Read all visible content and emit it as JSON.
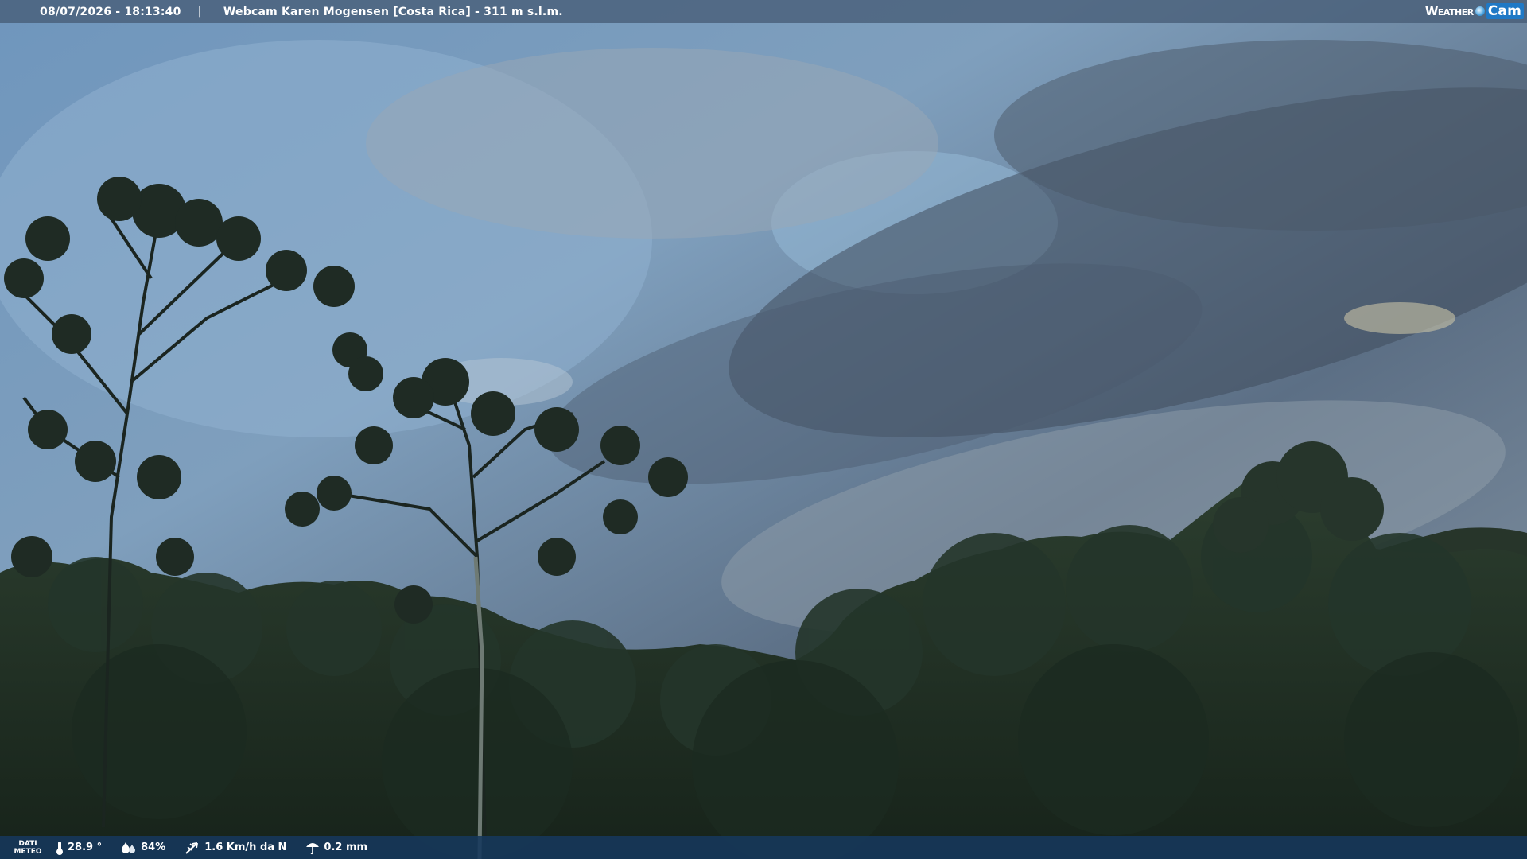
{
  "header": {
    "timestamp": "08/07/2026 - 18:13:40",
    "separator": "|",
    "title": "Webcam Karen Mogensen [Costa Rica]  - 311 m s.l.m."
  },
  "logo": {
    "word1": "Weather",
    "word2": "Cam"
  },
  "weather": {
    "label_line1": "DATI",
    "label_line2": "METEO",
    "temperature": "28.9 °",
    "humidity": "84%",
    "wind": "1.6 Km/h da N",
    "rain": "0.2 mm"
  },
  "colors": {
    "top_bar": "#465c76",
    "bottom_bar": "#16385c",
    "logo_accent": "#1f79c6"
  }
}
